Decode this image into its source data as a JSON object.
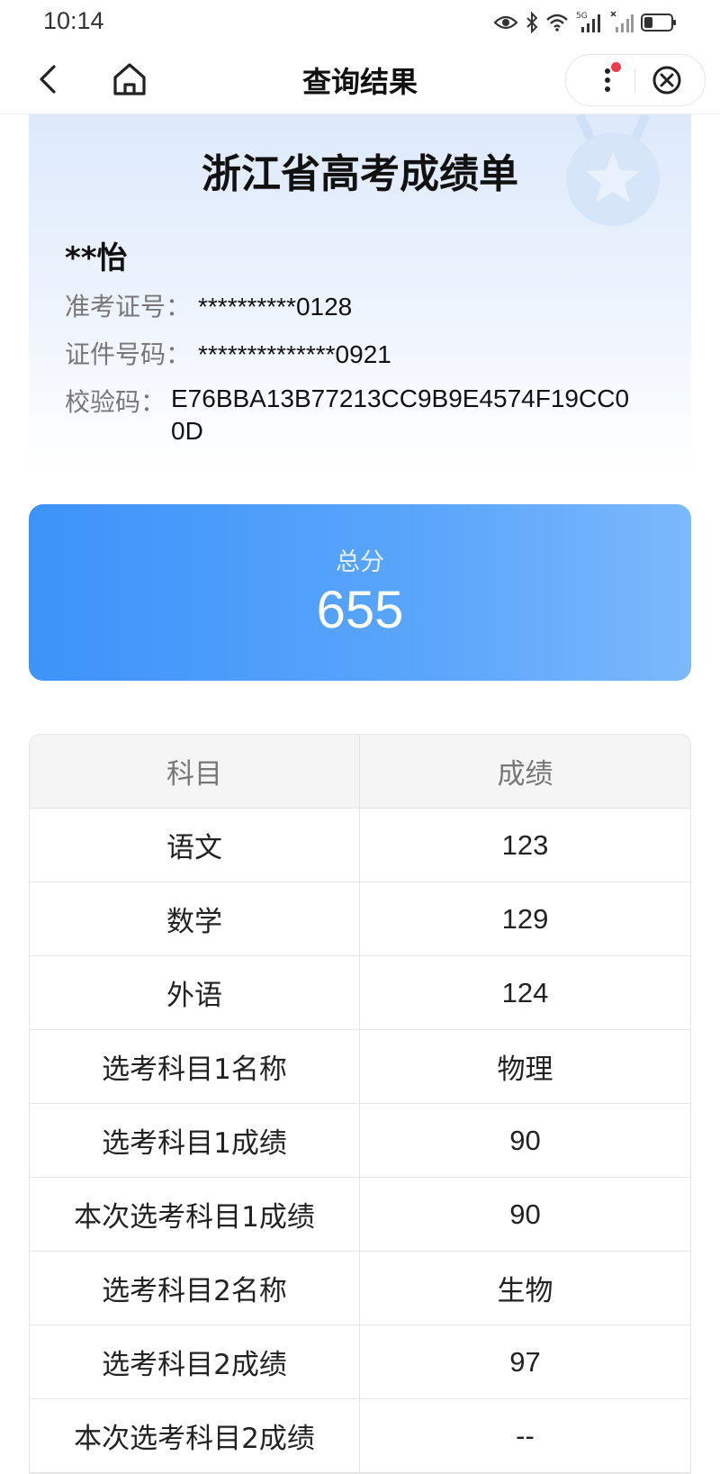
{
  "status_bar": {
    "time": "10:14",
    "icons": [
      "eye-icon",
      "bluetooth-icon",
      "wifi-icon",
      "signal-5g-icon",
      "signal-icon",
      "battery-icon"
    ],
    "network_label": "5G"
  },
  "nav": {
    "title": "查询结果",
    "back_icon": "chevron-left-icon",
    "home_icon": "home-icon",
    "more_icon": "more-vertical-icon",
    "close_icon": "close-circle-icon"
  },
  "header_card": {
    "title": "浙江省高考成绩单",
    "name": "**怡",
    "admission_label": "准考证号：",
    "admission_value": "**********0128",
    "id_label": "证件号码：",
    "id_value": "**************0921",
    "check_label": "校验码：",
    "check_value": "E76BBA13B77213CC9B9E4574F19CC00D"
  },
  "total": {
    "label": "总分",
    "value": "655"
  },
  "table": {
    "headers": [
      "科目",
      "成绩"
    ],
    "rows": [
      [
        "语文",
        "123"
      ],
      [
        "数学",
        "129"
      ],
      [
        "外语",
        "124"
      ],
      [
        "选考科目1名称",
        "物理"
      ],
      [
        "选考科目1成绩",
        "90"
      ],
      [
        "本次选考科目1成绩",
        "90"
      ],
      [
        "选考科目2名称",
        "生物"
      ],
      [
        "选考科目2成绩",
        "97"
      ],
      [
        "本次选考科目2成绩",
        "--"
      ]
    ]
  },
  "colors": {
    "accent_blue": "#3d93f9",
    "notification_dot": "#f03a4d",
    "header_bg": "#dde9fb"
  }
}
